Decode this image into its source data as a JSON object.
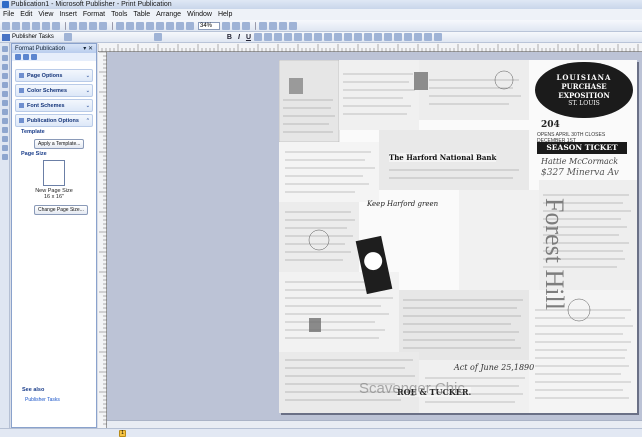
{
  "window": {
    "title": "Publication1 - Microsoft Publisher - Print Publication"
  },
  "menu": [
    "File",
    "Edit",
    "View",
    "Insert",
    "Format",
    "Tools",
    "Table",
    "Arrange",
    "Window",
    "Help"
  ],
  "toolbar": {
    "zoom": "34%",
    "publisher_tasks": "Publisher Tasks"
  },
  "task_pane": {
    "title": "Format Publication",
    "sections": [
      "Page Options",
      "Color Schemes",
      "Font Schemes",
      "Publication Options"
    ],
    "template_label": "Template",
    "apply_template": "Apply a Template...",
    "page_size_label": "Page Size",
    "page_size_name": "New Page Size",
    "page_size_dims": "16 x 16\"",
    "change_page_size": "Change Page Size...",
    "see_also": "See also",
    "see_also_link": "Publisher Tasks"
  },
  "page": {
    "expo_line1": "LOUISIANA",
    "expo_line2": "PURCHASE",
    "expo_line3": "EXPOSITION",
    "expo_line4": "ST. LOUIS",
    "ticket_number": "204",
    "ticket_text": "OPENS APRIL 30TH CLOSES DECEMBER 1ST",
    "season_ticket": "SEASON TICKET",
    "script_name": "Hattie McCormack",
    "address": "$327 Minerva Av",
    "bank": "The Harford National Bank",
    "keep": "Keep Harford green",
    "title_text": "Forest Hill",
    "act": "Act of June 25,1890",
    "roe": "ROE & TUCKER.",
    "watermark": "Scavenger Chic"
  },
  "status": {
    "page_number": "1"
  }
}
